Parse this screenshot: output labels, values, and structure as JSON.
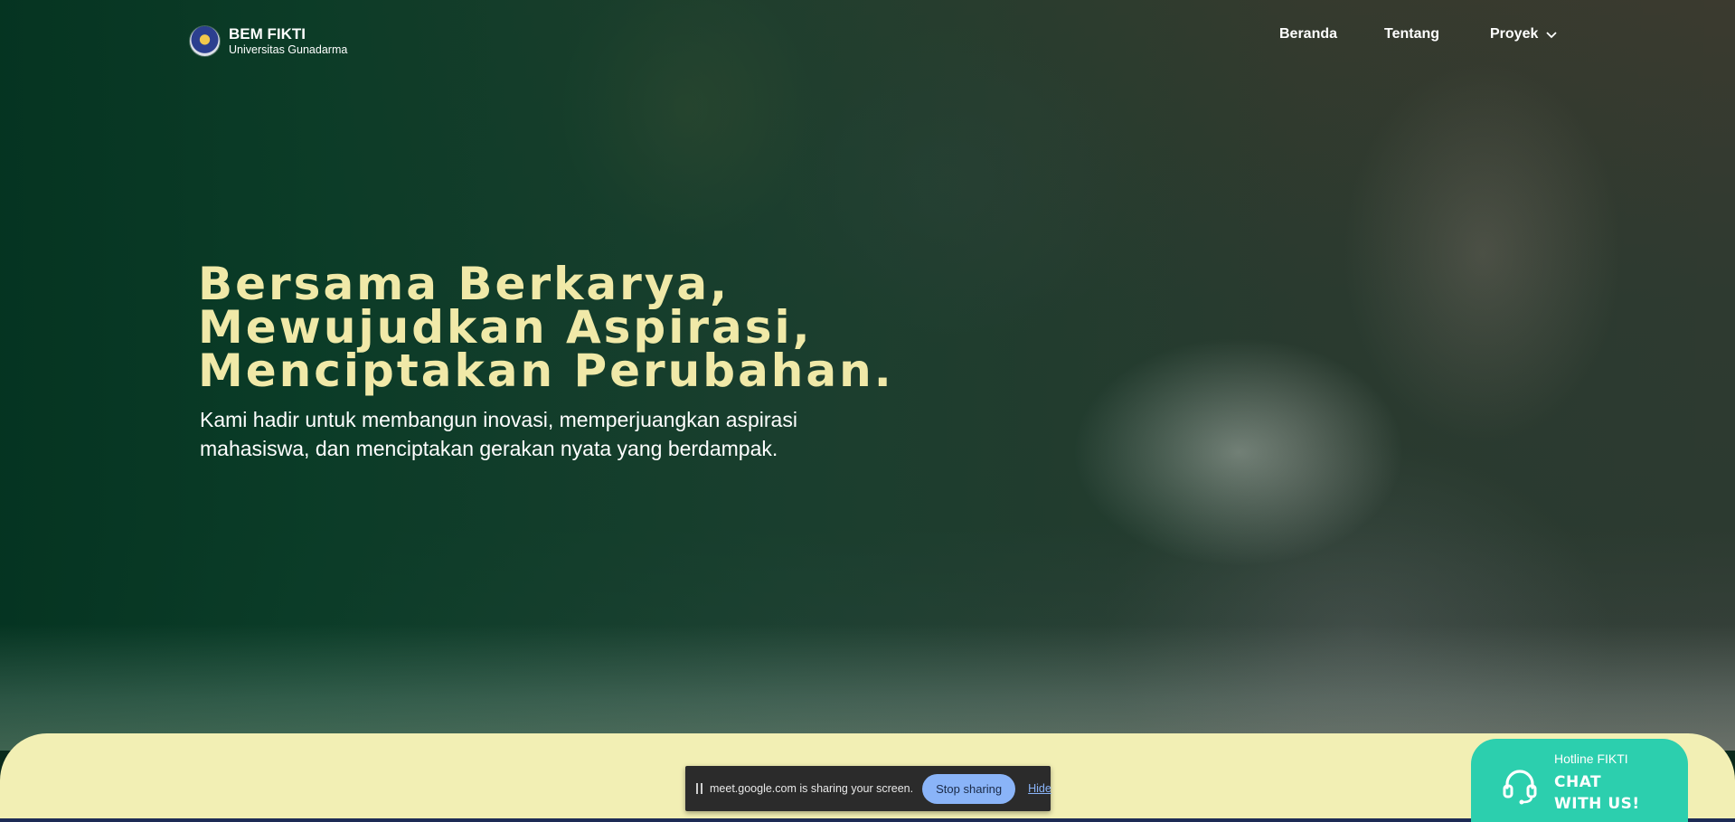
{
  "brand": {
    "title": "BEM FIKTI",
    "subtitle": "Universitas Gunadarma",
    "logo_icon": "university-crest-icon"
  },
  "nav": {
    "items": [
      {
        "label": "Beranda"
      },
      {
        "label": "Tentang"
      },
      {
        "label": "Proyek",
        "icon": "chevron-down-icon"
      }
    ]
  },
  "hero": {
    "headline_lines": [
      "Bersama Berkarya,",
      "Mewujudkan Aspirasi,",
      "Menciptakan Perubahan."
    ],
    "subtext_lines": [
      "Kami hadir untuk membangun inovasi, memperjuangkan aspirasi",
      "mahasiswa, dan menciptakan gerakan nyata yang berdampak."
    ]
  },
  "screen_share": {
    "message": "meet.google.com is sharing your screen.",
    "stop_label": "Stop sharing",
    "hide_label": "Hide"
  },
  "hotline": {
    "label": "Hotline FIKTI",
    "cta_lines": [
      "CHAT",
      "WITH US!"
    ],
    "icon": "headset-icon"
  },
  "colors": {
    "headline": "#f0e9a8",
    "overlay_green": "#043421",
    "band": "#f2efb4",
    "hotline": "#2ccfae",
    "share_button": "#8ab4f8"
  }
}
